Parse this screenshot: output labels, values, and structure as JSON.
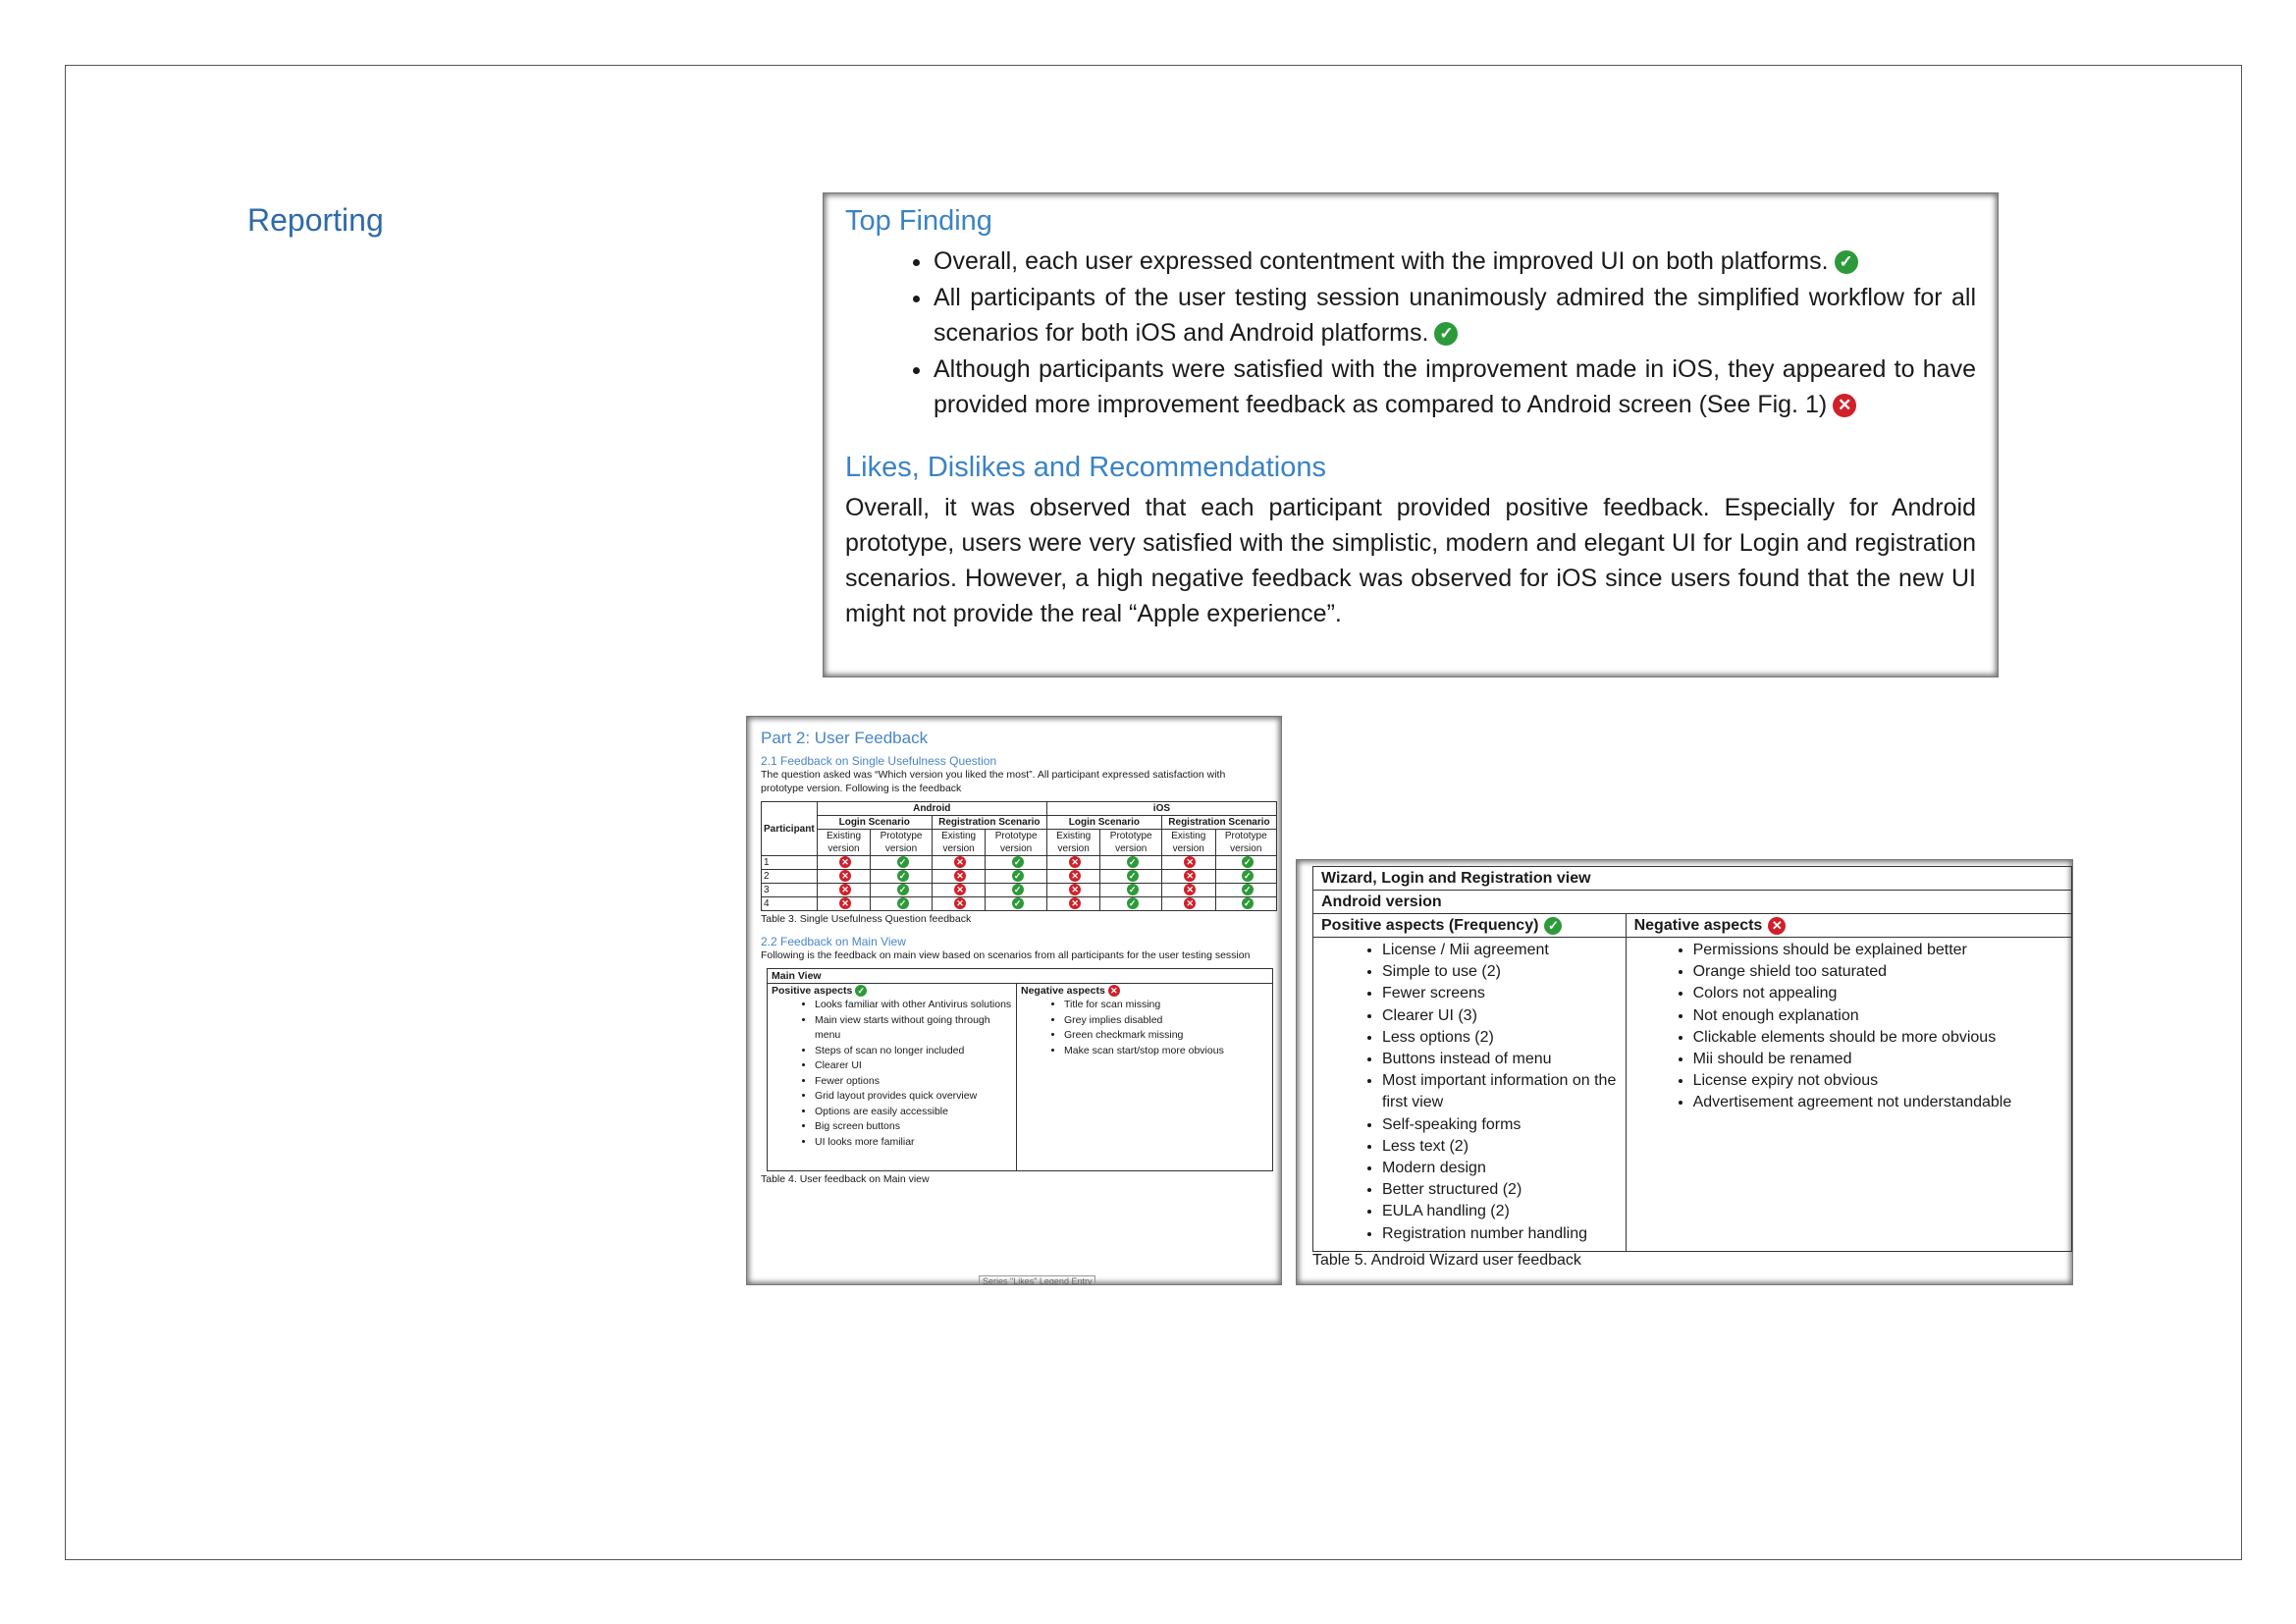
{
  "section_title": "Reporting",
  "top_finding": {
    "heading": "Top Finding",
    "bullets": [
      {
        "text": "Overall, each user expressed contentment with the improved UI on both platforms.",
        "status": "positive"
      },
      {
        "text": "All participants of the user testing session unanimously admired the simplified workflow for all scenarios for both iOS and Android platforms.",
        "status": "positive"
      },
      {
        "text": "Although participants were satisfied with the improvement made in iOS, they appeared to have provided more improvement feedback as compared to Android screen (See Fig. 1)",
        "status": "negative"
      }
    ],
    "likes_heading": "Likes, Dislikes and Recommendations",
    "likes_text": "Overall, it was observed that each participant provided positive feedback. Especially for Android prototype, users were very satisfied with the simplistic, modern and elegant UI for Login and registration scenarios. However, a high negative feedback was observed for iOS since users found that the new UI might not provide the real “Apple experience”."
  },
  "user_feedback": {
    "title": "Part 2: User Feedback",
    "sub1": "2.1 Feedback on Single Usefulness Question",
    "intro1": "The question asked was “Which version you liked the most”. All participant expressed satisfaction with prototype version. Following is the feedback",
    "table3": {
      "participant_header": "Participant",
      "android": "Android",
      "ios": "iOS",
      "login": "Login Scenario",
      "registration": "Registration Scenario",
      "existing": "Existing version",
      "prototype": "Prototype version",
      "rows": [
        {
          "id": "1",
          "marks": [
            "x",
            "v",
            "x",
            "v",
            "x",
            "v",
            "x",
            "v"
          ]
        },
        {
          "id": "2",
          "marks": [
            "x",
            "v",
            "x",
            "v",
            "x",
            "v",
            "x",
            "v"
          ]
        },
        {
          "id": "3",
          "marks": [
            "x",
            "v",
            "x",
            "v",
            "x",
            "v",
            "x",
            "v"
          ]
        },
        {
          "id": "4",
          "marks": [
            "x",
            "v",
            "x",
            "v",
            "x",
            "v",
            "x",
            "v"
          ]
        }
      ],
      "caption": "Table 3.  Single Usefulness Question feedback"
    },
    "sub2": "2.2 Feedback on Main View",
    "intro2": "Following is the feedback on main view based on scenarios from all participants for the user testing session",
    "main_view": {
      "header": "Main View",
      "positive_header": "Positive aspects",
      "negative_header": "Negative aspects",
      "positive": [
        "Looks familiar with other Antivirus solutions",
        "Main view starts without going through menu",
        "Steps of scan no longer included",
        "Clearer UI",
        "Fewer options",
        "Grid layout provides quick overview",
        "Options are easily accessible",
        "Big screen buttons",
        "UI looks more familiar"
      ],
      "negative": [
        "Title for scan missing",
        "Grey implies disabled",
        "Green checkmark missing",
        "Make scan start/stop more obvious"
      ],
      "caption": "Table 4.  User feedback on Main view"
    },
    "legend": "Series \"Likes\" Legend Entry"
  },
  "android_wizard": {
    "title": "Wizard, Login and Registration view",
    "version": "Android version",
    "positive_header": "Positive aspects (Frequency)",
    "negative_header": "Negative aspects",
    "positive": [
      "License / Mii agreement",
      "Simple to use (2)",
      "Fewer screens",
      "Clearer UI (3)",
      "Less options (2)",
      "Buttons instead of menu",
      "Most important information on the first view",
      "Self-speaking forms",
      "Less text (2)",
      "Modern design",
      "Better structured (2)",
      "EULA handling (2)",
      "Registration number handling"
    ],
    "negative": [
      "Permissions should be explained better",
      "Orange shield too saturated",
      "Colors not appealing",
      "Not enough explanation",
      "Clickable elements should be more obvious",
      "Mii should be renamed",
      "License expiry not obvious",
      "Advertisement agreement  not understandable"
    ],
    "caption": "Table 5.  Android Wizard user feedback"
  },
  "colors": {
    "heading_blue": "#3a83c4",
    "check_green": "#2d9a3a",
    "cross_red": "#d0202a"
  }
}
